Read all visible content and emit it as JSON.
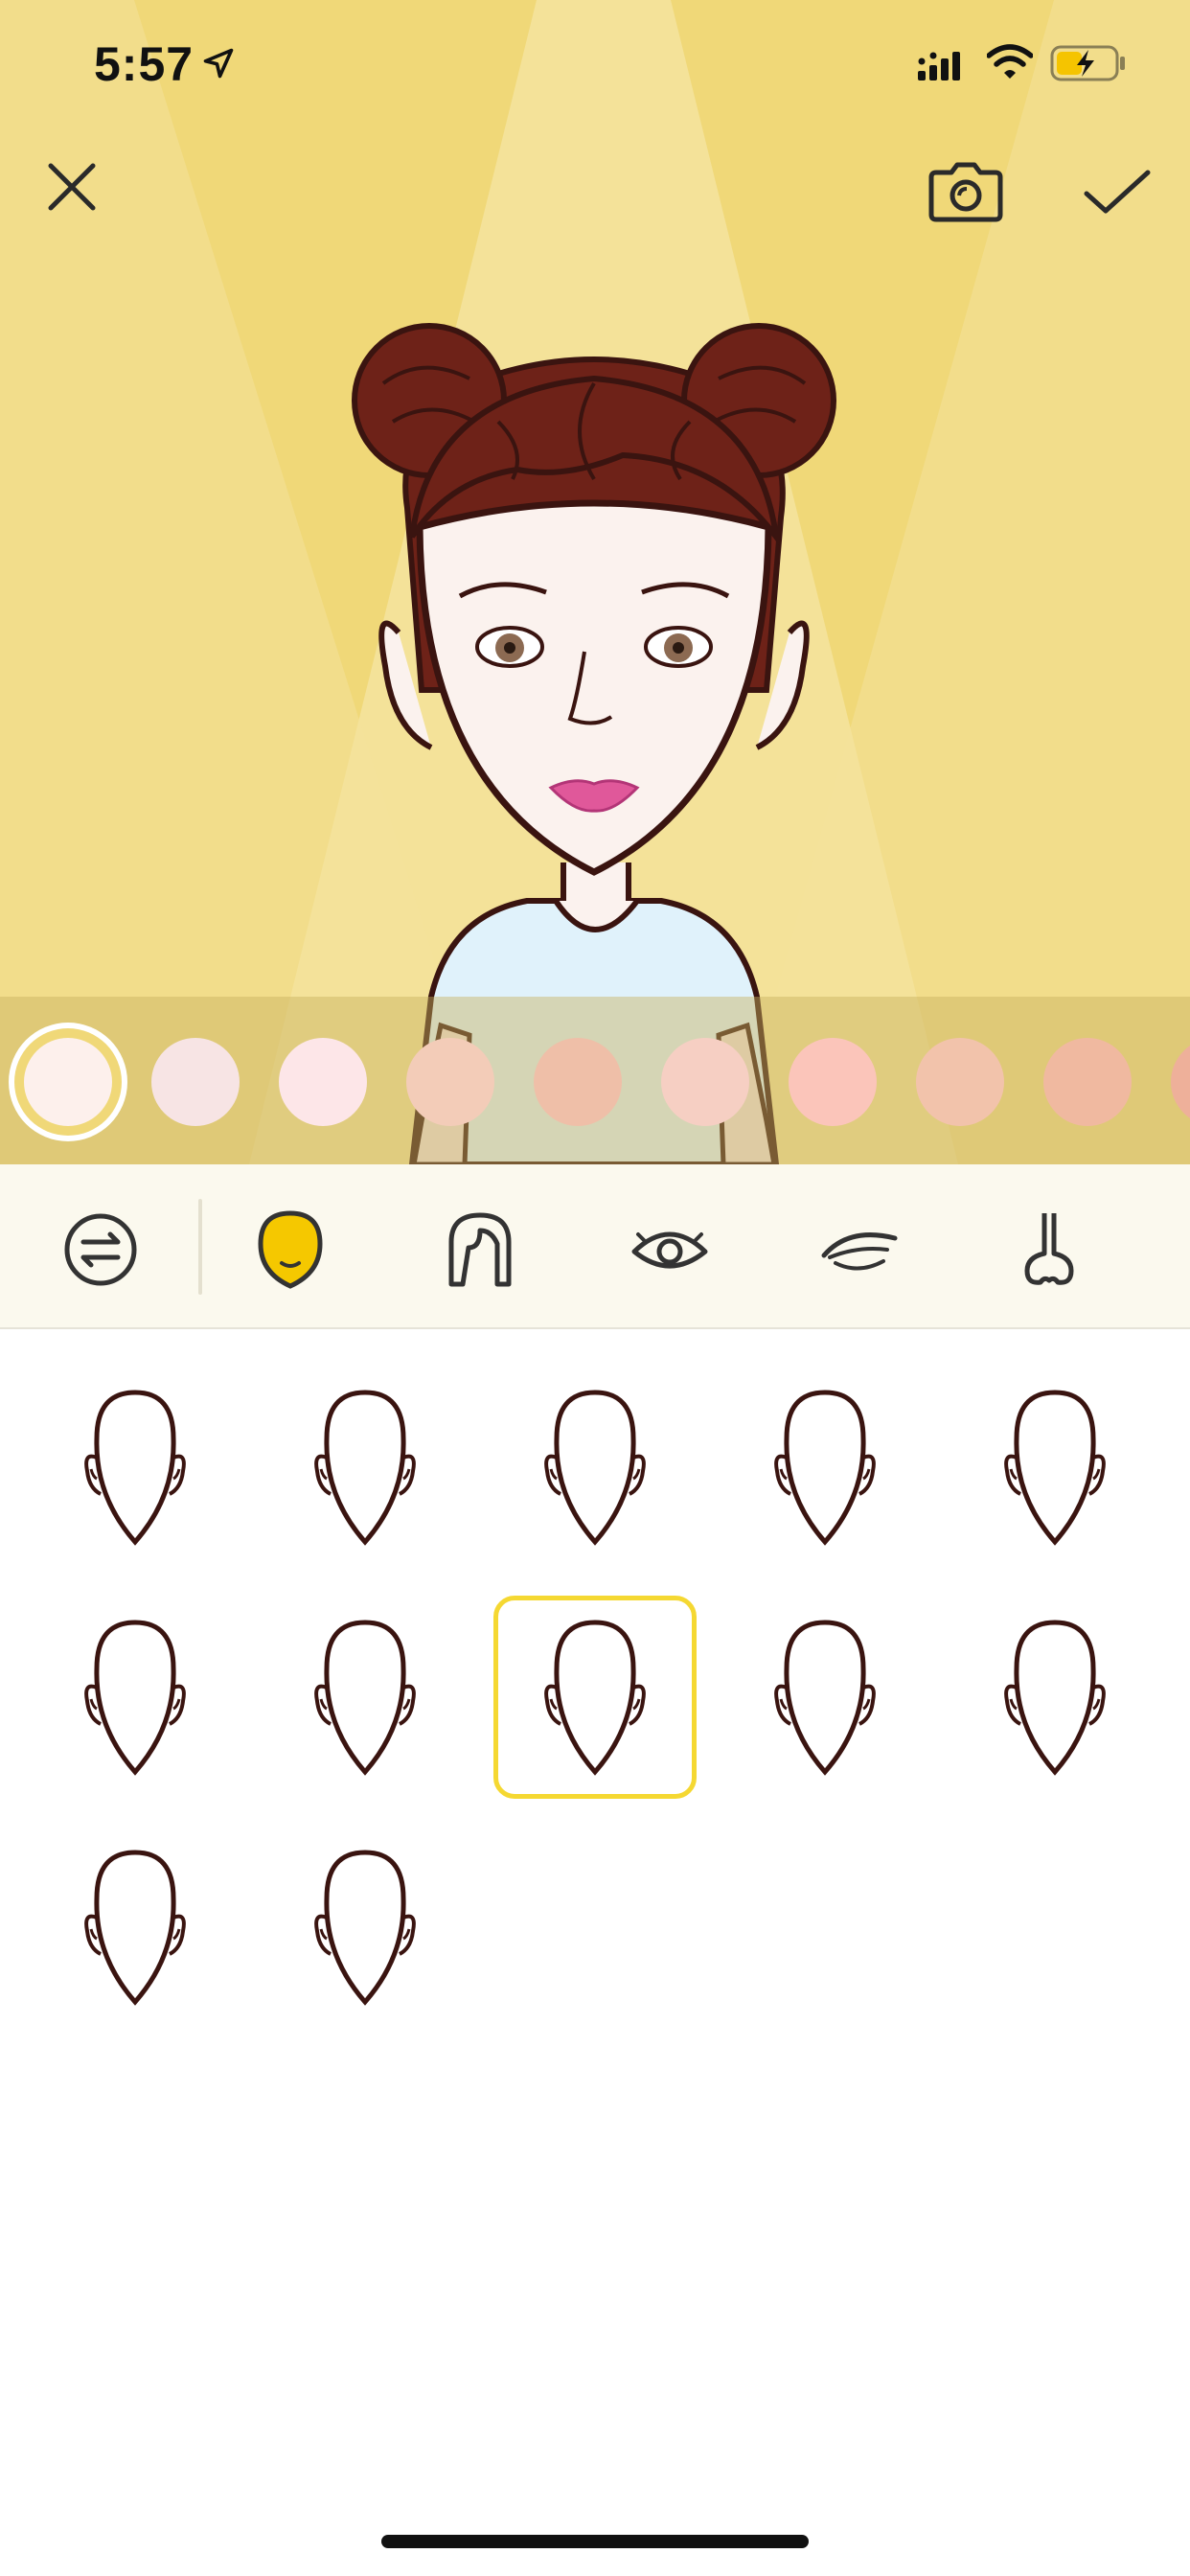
{
  "status_bar": {
    "time": "5:57",
    "icons": [
      "location-arrow-icon",
      "cellular-signal-icon",
      "wifi-icon",
      "battery-charging-icon"
    ]
  },
  "header": {
    "close_icon": "close-icon",
    "camera_icon": "camera-icon",
    "confirm_icon": "checkmark-icon"
  },
  "colors": {
    "stage_background": "#f0d878",
    "accent": "#f5d832",
    "hair": "#6e2218",
    "outline": "#3a1410"
  },
  "skin_tones": [
    {
      "color": "#fdf0ec",
      "selected": true
    },
    {
      "color": "#f7e4e4",
      "selected": false
    },
    {
      "color": "#fde6e8",
      "selected": false
    },
    {
      "color": "#f3ccb8",
      "selected": false
    },
    {
      "color": "#efbfa8",
      "selected": false
    },
    {
      "color": "#f6cfc3",
      "selected": false
    },
    {
      "color": "#fbc5ba",
      "selected": false
    },
    {
      "color": "#f2c3ab",
      "selected": false
    },
    {
      "color": "#f0b9a0",
      "selected": false
    },
    {
      "color": "#eeb09a",
      "selected": false
    }
  ],
  "toolbar": {
    "items": [
      {
        "name": "swap",
        "icon": "swap-arrows-icon",
        "active": false
      },
      {
        "name": "face",
        "icon": "face-shape-icon",
        "active": true
      },
      {
        "name": "hair",
        "icon": "hair-icon",
        "active": false
      },
      {
        "name": "eyes",
        "icon": "eye-icon",
        "active": false
      },
      {
        "name": "eyebrows",
        "icon": "eyebrow-icon",
        "active": false
      },
      {
        "name": "nose",
        "icon": "nose-icon",
        "active": false
      }
    ]
  },
  "face_shapes": {
    "count": 12,
    "selected_index": 7
  }
}
